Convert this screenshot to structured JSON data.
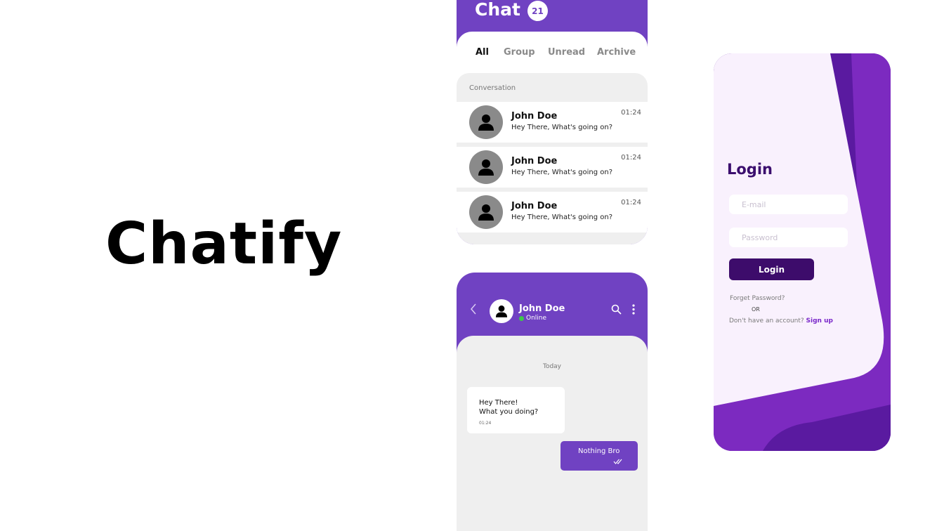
{
  "brand": {
    "name": "Chatify"
  },
  "chat_list": {
    "title": "Chat",
    "badge": "21",
    "tabs": [
      {
        "label": "All",
        "active": true
      },
      {
        "label": "Group",
        "active": false
      },
      {
        "label": "Unread",
        "active": false
      },
      {
        "label": "Archive",
        "active": false
      }
    ],
    "section_label": "Conversation",
    "conversations": [
      {
        "name": "John Doe",
        "message": "Hey There, What's going on?",
        "time": "01:24"
      },
      {
        "name": "John Doe",
        "message": "Hey There, What's going on?",
        "time": "01:24"
      },
      {
        "name": "John Doe",
        "message": "Hey There, What's going on?",
        "time": "01:24"
      }
    ]
  },
  "conversation": {
    "contact_name": "John Doe",
    "status": "Online",
    "day_label": "Today",
    "incoming": {
      "text": "Hey There!\nWhat you doing?",
      "time": "01:24"
    },
    "outgoing": {
      "text": "Nothing Bro"
    }
  },
  "login": {
    "title": "Login",
    "email_placeholder": "E-mail",
    "password_placeholder": "Password",
    "button_label": "Login",
    "forgot_label": "Forget Password?",
    "or_label": "OR",
    "no_account_label": "Don't have an account?",
    "signup_label": "Sign up"
  },
  "colors": {
    "primary": "#7042c2",
    "dark_purple": "#3d0c6b",
    "light_gray": "#efefef",
    "online_green": "#3ec94a"
  },
  "icons": [
    "person-icon",
    "chevron-left-icon",
    "search-icon",
    "more-vertical-icon",
    "double-check-icon"
  ]
}
